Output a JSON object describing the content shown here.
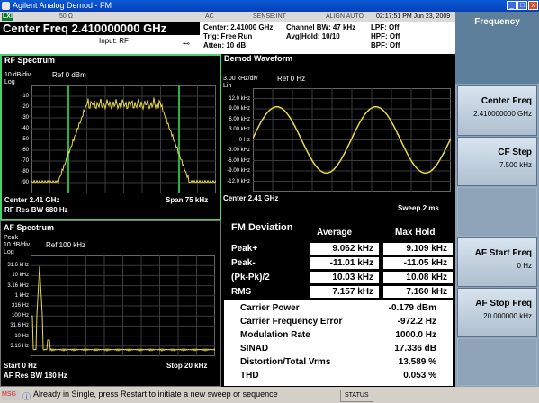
{
  "window": {
    "title": "Agilent Analog Demod - FM",
    "minimize": "_",
    "maximize": "□",
    "close": "x"
  },
  "statusbar": {
    "lxi": "LXI",
    "impedance": "50 Ω",
    "coupling": "AC",
    "sense": "SENSE:INT",
    "align": "ALIGN AUTO",
    "datetime": "02:17:51 PM Jun 23, 2009"
  },
  "header": {
    "center_freq_display": "Center Freq  2.410000000 GHz",
    "input": "Input: RF",
    "center": "Center: 2.41000 GHz",
    "trig": "Trig: Free Run",
    "atten": "Atten: 10 dB",
    "channel_bw": "Channel BW: 47 kHz",
    "avg_hold": "Avg|Hold: 10/10",
    "lpf": "LPF: Off",
    "hpf": "HPF: Off",
    "bpf": "BPF: Off"
  },
  "softkeys": {
    "title": "Frequency",
    "items": [
      {
        "label": "Center Freq",
        "value": "2.410000000 GHz"
      },
      {
        "label": "CF Step",
        "value": "7.500 kHz"
      },
      {
        "label": "",
        "value": ""
      },
      {
        "label": "AF Start Freq",
        "value": "0 Hz"
      },
      {
        "label": "AF Stop Freq",
        "value": "20.000000 kHz"
      }
    ]
  },
  "rf": {
    "title": "RF Spectrum",
    "scale": "10 dB/div",
    "ref": "Ref  0 dBm",
    "scale_type": "Log",
    "yticks": [
      "-10",
      "-20",
      "-30",
      "-40",
      "-50",
      "-60",
      "-70",
      "-80",
      "-90"
    ],
    "center": "Center  2.41 GHz",
    "span": "Span 75 kHz",
    "res_bw": "RF Res BW   680 Hz"
  },
  "demod": {
    "title": "Demod Waveform",
    "scale": "3.00 kHz/div",
    "ref": "Ref 0 Hz",
    "scale_type": "Lin",
    "yticks": [
      "12.0 kHz",
      "9.00 kHz",
      "6.00 kHz",
      "3.00 kHz",
      "0 Hz",
      "-3.00 kHz",
      "-6.00 kHz",
      "-9.00 kHz",
      "-12.0 kHz"
    ],
    "center": "Center  2.41 GHz",
    "sweep": "Sweep  2 ms"
  },
  "af": {
    "title": "AF Spectrum",
    "detector": "Peak",
    "scale": "10 dB/div",
    "ref": "Ref 100 kHz",
    "scale_type": "Log",
    "yticks": [
      "31.6 kHz",
      "10 kHz",
      "3.16 kHz",
      "1 kHz",
      "316 Hz",
      "100 Hz",
      "31.6 Hz",
      "10 Hz",
      "3.16 Hz"
    ],
    "start": "Start  0 Hz",
    "stop": "Stop 20 kHz",
    "res_bw": "AF Res BW   180 Hz"
  },
  "fm": {
    "title": "FM Deviation",
    "col_avg": "Average",
    "col_max": "Max Hold",
    "rows": [
      {
        "label": "Peak+",
        "avg": "9.062 kHz",
        "max": "9.109 kHz"
      },
      {
        "label": "Peak-",
        "avg": "-11.01 kHz",
        "max": "-11.05 kHz"
      },
      {
        "label": "(Pk-Pk)/2",
        "avg": "10.03 kHz",
        "max": "10.08 kHz"
      },
      {
        "label": "RMS",
        "avg": "7.157 kHz",
        "max": "7.160 kHz"
      }
    ],
    "metrics": [
      {
        "label": "Carrier Power",
        "value": "-0.179 dBm"
      },
      {
        "label": "Carrier Frequency Error",
        "value": "-972.2 Hz"
      },
      {
        "label": "Modulation Rate",
        "value": "1000.0 Hz"
      },
      {
        "label": "SINAD",
        "value": "17.336 dB"
      },
      {
        "label": "Distortion/Total Vrms",
        "value": "13.589 %"
      },
      {
        "label": "THD",
        "value": "0.053 %"
      }
    ]
  },
  "bottom": {
    "msg": "MSG",
    "message": "Already in Single, press Restart to initiate a new sweep or sequence",
    "status": "STATUS"
  },
  "colors": {
    "trace": "#e8d84a",
    "marker": "#22b34a",
    "active_border": "#4bd36b"
  }
}
